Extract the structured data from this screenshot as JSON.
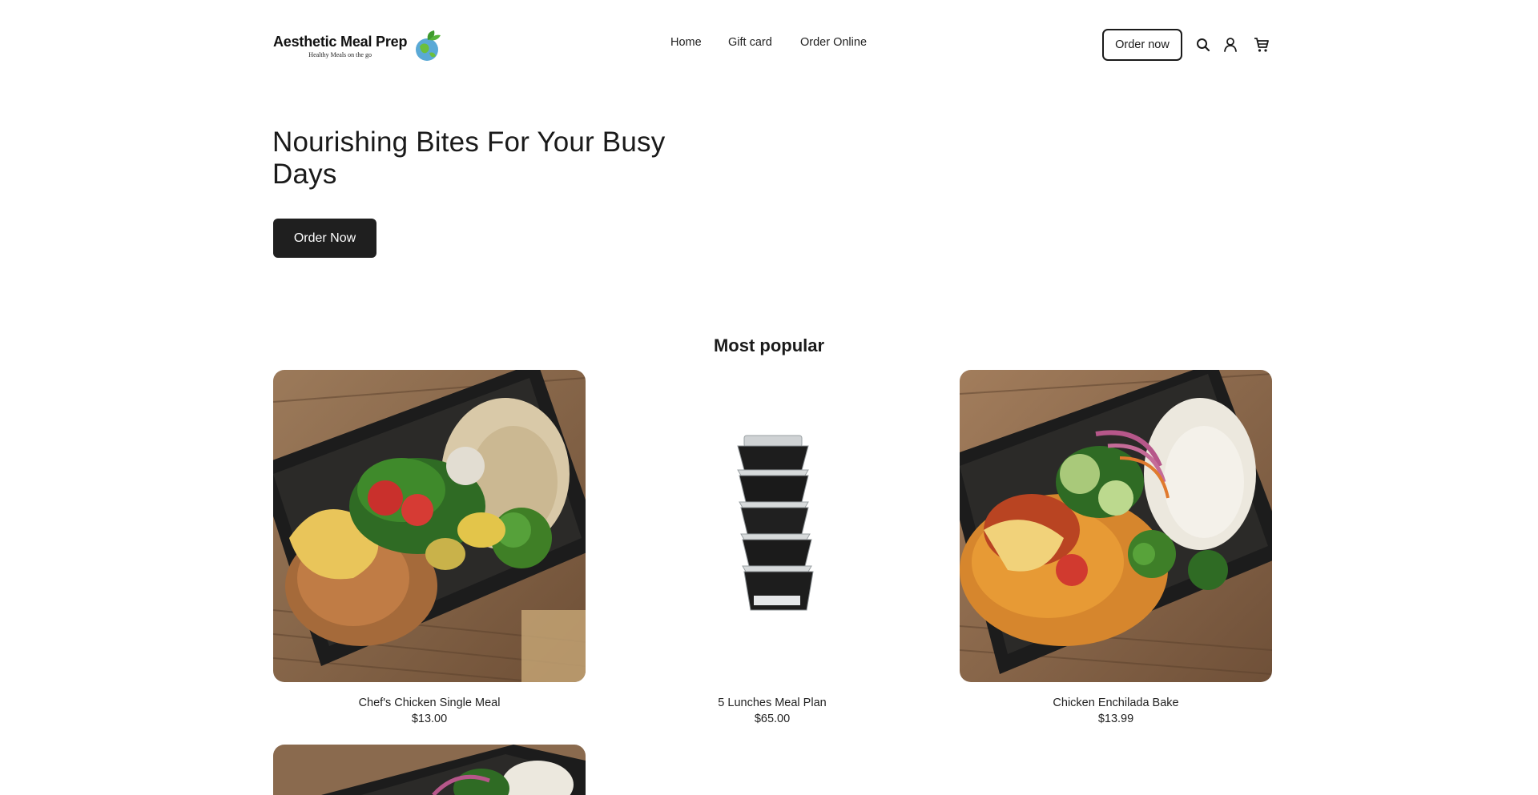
{
  "brand": {
    "name": "Aesthetic Meal Prep",
    "tagline": "Healthy Meals on the go"
  },
  "nav": {
    "items": [
      "Home",
      "Gift card",
      "Order Online"
    ]
  },
  "header": {
    "order_button": "Order now",
    "icons": [
      "search-icon",
      "account-icon",
      "cart-icon"
    ]
  },
  "hero": {
    "title": "Nourishing Bites For Your Busy Days",
    "cta": "Order Now"
  },
  "products": {
    "heading": "Most popular",
    "items": [
      {
        "name": "Chef's Chicken Single Meal",
        "price": "$13.00"
      },
      {
        "name": "5 Lunches Meal Plan",
        "price": "$65.00"
      },
      {
        "name": "Chicken Enchilada Bake",
        "price": "$13.99"
      }
    ]
  },
  "colors": {
    "text": "#1a1a1a",
    "button_dark": "#1f1f1f",
    "background": "#ffffff"
  }
}
